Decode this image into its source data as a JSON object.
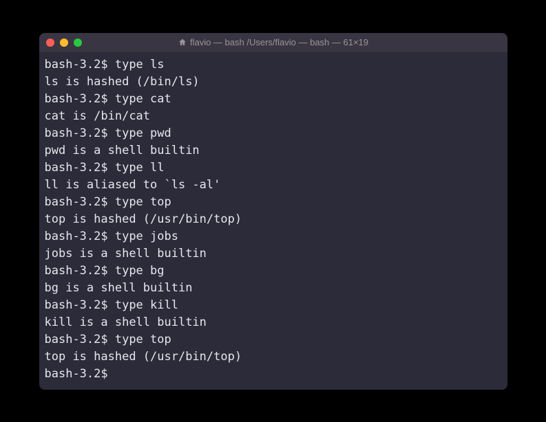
{
  "window": {
    "title": "flavio — bash /Users/flavio — bash — 61×19"
  },
  "terminal": {
    "prompt": "bash-3.2$",
    "lines": [
      {
        "type": "command",
        "text": "type ls"
      },
      {
        "type": "output",
        "text": "ls is hashed (/bin/ls)"
      },
      {
        "type": "command",
        "text": "type cat"
      },
      {
        "type": "output",
        "text": "cat is /bin/cat"
      },
      {
        "type": "command",
        "text": "type pwd"
      },
      {
        "type": "output",
        "text": "pwd is a shell builtin"
      },
      {
        "type": "command",
        "text": "type ll"
      },
      {
        "type": "output",
        "text": "ll is aliased to `ls -al'"
      },
      {
        "type": "command",
        "text": "type top"
      },
      {
        "type": "output",
        "text": "top is hashed (/usr/bin/top)"
      },
      {
        "type": "command",
        "text": "type jobs"
      },
      {
        "type": "output",
        "text": "jobs is a shell builtin"
      },
      {
        "type": "command",
        "text": "type bg"
      },
      {
        "type": "output",
        "text": "bg is a shell builtin"
      },
      {
        "type": "command",
        "text": "type kill"
      },
      {
        "type": "output",
        "text": "kill is a shell builtin"
      },
      {
        "type": "command",
        "text": "type top"
      },
      {
        "type": "output",
        "text": "top is hashed (/usr/bin/top)"
      },
      {
        "type": "prompt-only",
        "text": ""
      }
    ]
  }
}
